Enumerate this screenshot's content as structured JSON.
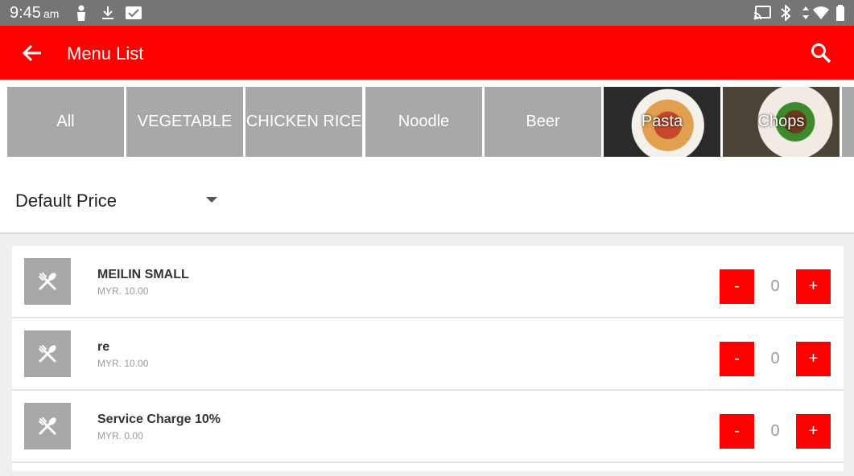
{
  "status_bar": {
    "time": "9:45",
    "ampm": "am",
    "icons": [
      "person-icon",
      "download-icon",
      "message-icon",
      "cast-icon",
      "bluetooth-icon",
      "data-arrows-icon",
      "wifi-icon",
      "battery-icon"
    ]
  },
  "app_bar": {
    "title": "Menu List",
    "back_icon": "arrow-back-icon",
    "search_icon": "search-icon",
    "color": "#ff0000"
  },
  "categories": [
    {
      "label": "All"
    },
    {
      "label": "VEGETABLE"
    },
    {
      "label": "CHICKEN RICE"
    },
    {
      "label": "Noodle"
    },
    {
      "label": "Beer"
    },
    {
      "label": "Pasta"
    },
    {
      "label": "Chops"
    }
  ],
  "price_selector": {
    "value": "Default Price",
    "caret_icon": "dropdown-caret-icon"
  },
  "items": [
    {
      "name": "MEILIN SMALL",
      "price": "MYR. 10.00",
      "qty": "0",
      "minus": "-",
      "plus": "+"
    },
    {
      "name": "re",
      "price": "MYR. 10.00",
      "qty": "0",
      "minus": "-",
      "plus": "+"
    },
    {
      "name": "Service Charge 10%",
      "price": "MYR. 0.00",
      "qty": "0",
      "minus": "-",
      "plus": "+"
    }
  ],
  "colors": {
    "accent": "#ff0000",
    "status_bar": "#757575",
    "category_bg": "#a8a8a8"
  }
}
